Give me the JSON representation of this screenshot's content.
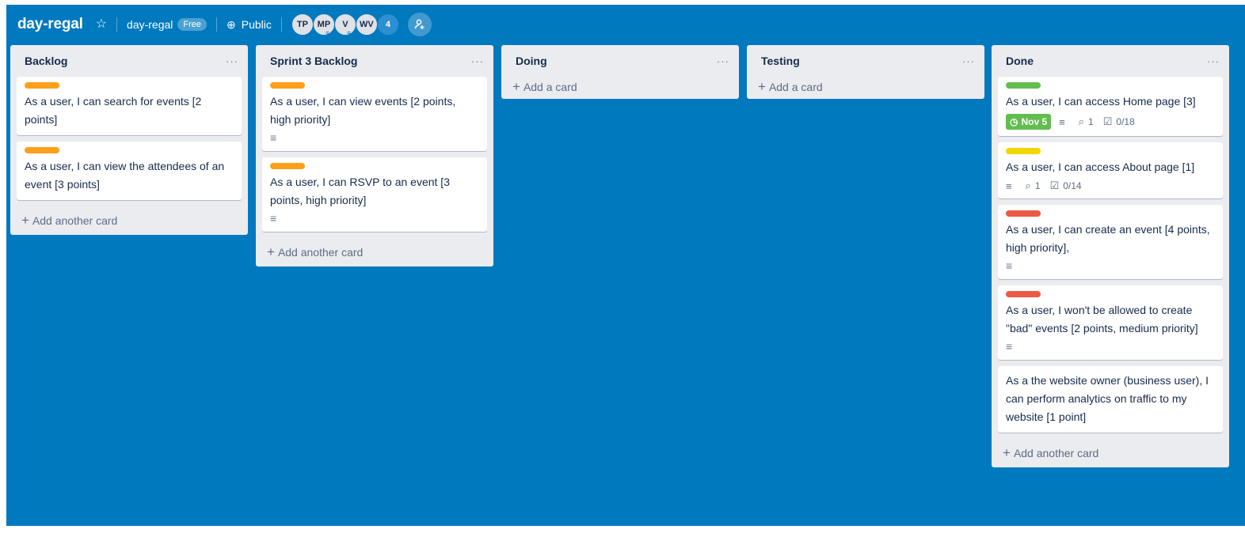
{
  "header": {
    "board_title": "day-regal",
    "team_name": "day-regal",
    "team_badge": "Free",
    "visibility": "Public",
    "members": [
      {
        "initials": "TP"
      },
      {
        "initials": "MP"
      },
      {
        "initials": "V"
      },
      {
        "initials": "WV"
      }
    ],
    "member_count": "4"
  },
  "lists": [
    {
      "title": "Backlog",
      "menu": "···",
      "add_label": "Add another card",
      "cards": [
        {
          "label_color": "#ff9f1a",
          "title": "As a user, I can search for events [2 points]"
        },
        {
          "label_color": "#ff9f1a",
          "title": "As a user, I can view the attendees of an event [3 points]"
        }
      ]
    },
    {
      "title": "Sprint 3 Backlog",
      "menu": "···",
      "add_label": "Add another card",
      "cards": [
        {
          "label_color": "#ff9f1a",
          "title": "As a user, I can view events [2 points, high priority]",
          "has_description": true
        },
        {
          "label_color": "#ff9f1a",
          "title": "As a user, I can RSVP to an event [3 points, high priority]",
          "has_description": true
        }
      ]
    },
    {
      "title": "Doing",
      "menu": "···",
      "add_label": "Add a card",
      "cards": []
    },
    {
      "title": "Testing",
      "menu": "···",
      "add_label": "Add a card",
      "cards": []
    },
    {
      "title": "Done",
      "menu": "···",
      "add_label": "Add another card",
      "cards": [
        {
          "label_color": "#61bd4f",
          "title": "As a user, I can access Home page [3]",
          "due": "Nov 5",
          "comments": "1",
          "checklist": "0/18"
        },
        {
          "label_color": "#f2d600",
          "title": "As a user, I can access About page [1]",
          "comments": "1",
          "checklist": "0/14"
        },
        {
          "label_color": "#eb5a46",
          "title": "As a user, I can create an event [4 points, high priority],",
          "has_description": true
        },
        {
          "label_color": "#eb5a46",
          "title": "As a user, I won't be allowed to create \"bad\" events [2 points, medium priority]",
          "has_description": true
        },
        {
          "title": "As a the website owner (business user), I can perform analytics on traffic to my website [1 point]"
        }
      ]
    }
  ],
  "colors": {
    "board_bg": "#0079bf",
    "list_bg": "#ebecf0",
    "card_bg": "#ffffff",
    "label_orange": "#ff9f1a",
    "label_green": "#61bd4f",
    "label_yellow": "#f2d600",
    "label_red": "#eb5a46"
  },
  "icons": {
    "star": "star-icon",
    "globe": "globe-icon",
    "description": "description-icon",
    "comment": "comment-icon",
    "checklist": "checklist-icon",
    "clock": "clock-icon",
    "invite": "add-member-icon"
  }
}
